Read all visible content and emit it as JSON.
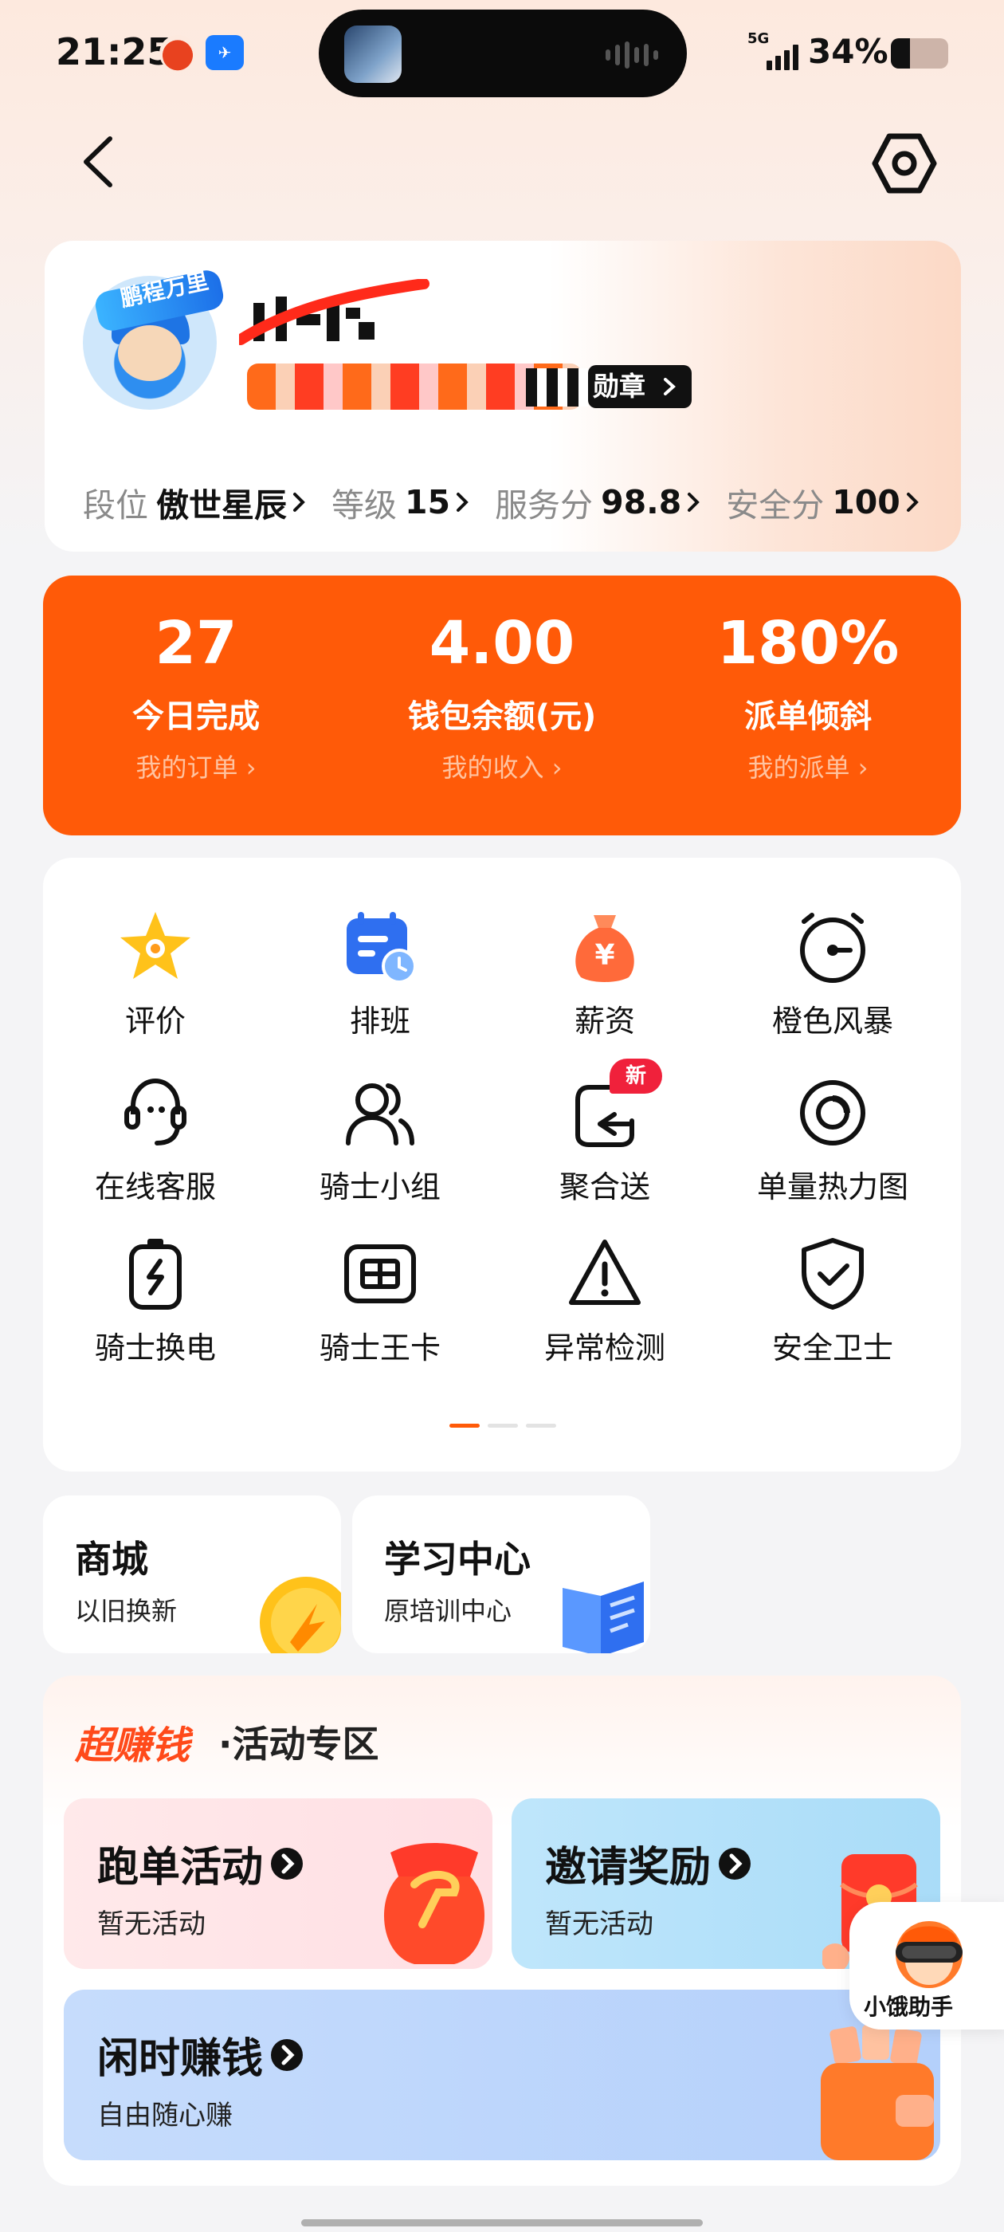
{
  "status_bar": {
    "time": "21:25",
    "network": "5G",
    "battery": "34%",
    "battery_level": 0.34
  },
  "profile": {
    "avatar_badge": "鹏程万里",
    "medal_label": "勋章",
    "stats": [
      {
        "label": "段位",
        "value": "傲世星辰"
      },
      {
        "label": "等级",
        "value": "15"
      },
      {
        "label": "服务分",
        "value": "98.8"
      },
      {
        "label": "安全分",
        "value": "100"
      }
    ]
  },
  "summary": [
    {
      "value": "27",
      "label": "今日完成",
      "link": "我的订单"
    },
    {
      "value": "4.00",
      "label": "钱包余额(元)",
      "link": "我的收入"
    },
    {
      "value": "180%",
      "label": "派单倾斜",
      "link": "我的派单"
    }
  ],
  "grid": {
    "items": [
      {
        "label": "评价",
        "icon": "star-badge-icon"
      },
      {
        "label": "排班",
        "icon": "calendar-clock-icon"
      },
      {
        "label": "薪资",
        "icon": "money-bag-icon"
      },
      {
        "label": "橙色风暴",
        "icon": "stopwatch-icon"
      },
      {
        "label": "在线客服",
        "icon": "headset-icon"
      },
      {
        "label": "骑士小组",
        "icon": "group-icon"
      },
      {
        "label": "聚合送",
        "icon": "aggregate-delivery-icon",
        "badge": "新"
      },
      {
        "label": "单量热力图",
        "icon": "target-icon"
      },
      {
        "label": "骑士换电",
        "icon": "battery-swap-icon"
      },
      {
        "label": "骑士王卡",
        "icon": "sim-card-icon"
      },
      {
        "label": "异常检测",
        "icon": "warning-icon"
      },
      {
        "label": "安全卫士",
        "icon": "shield-check-icon"
      }
    ],
    "page_count": 3,
    "current_page": 1
  },
  "tiles": [
    {
      "title": "商城",
      "subtitle": "以旧换新"
    },
    {
      "title": "学习中心",
      "subtitle": "原培训中心"
    }
  ],
  "activity": {
    "title_highlight": "超赚钱",
    "title_rest": "·活动专区",
    "cards": [
      {
        "title": "跑单活动",
        "subtitle": "暂无活动"
      },
      {
        "title": "邀请奖励",
        "subtitle": "暂无活动"
      },
      {
        "title": "闲时赚钱",
        "subtitle": "自由随心赚"
      }
    ]
  },
  "assistant": {
    "label": "小饿助手"
  },
  "colors": {
    "brand_orange": "#ff5a08",
    "badge_red": "#f0213b",
    "activity_red": "#ff4a1a"
  }
}
